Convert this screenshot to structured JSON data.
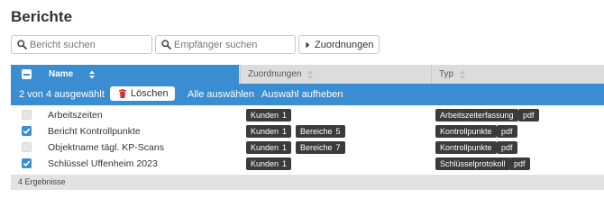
{
  "page": {
    "title": "Berichte"
  },
  "toolbar": {
    "report_search_placeholder": "Bericht suchen",
    "recipient_search_placeholder": "Empfänger suchen",
    "assignments_button": "Zuordnungen"
  },
  "table": {
    "columns": {
      "name": "Name",
      "assignments": "Zuordnungen",
      "type": "Typ"
    },
    "selection": {
      "count_text": "2 von 4 ausgewählt",
      "delete_label": "Löschen",
      "select_all": "Alle auswählen",
      "deselect": "Auswahl aufheben"
    },
    "rows": [
      {
        "name": "Arbeitszeiten",
        "checked": false,
        "kunden": {
          "label": "Kunden",
          "count": "1"
        },
        "bereiche": null,
        "type": "Arbeitszeiterfassung",
        "format": "pdf"
      },
      {
        "name": "Bericht Kontrollpunkte",
        "checked": true,
        "kunden": {
          "label": "Kunden",
          "count": "1"
        },
        "bereiche": {
          "label": "Bereiche",
          "count": "5"
        },
        "type": "Kontrollpunkte",
        "format": "pdf"
      },
      {
        "name": "Objektname tägl. KP-Scans",
        "checked": false,
        "kunden": {
          "label": "Kunden",
          "count": "1"
        },
        "bereiche": {
          "label": "Bereiche",
          "count": "7"
        },
        "type": "Kontrollpunkte",
        "format": "pdf"
      },
      {
        "name": "Schlüssel Uffenheim 2023",
        "checked": true,
        "kunden": {
          "label": "Kunden",
          "count": "1"
        },
        "bereiche": null,
        "type": "Schlüsselprotokoll",
        "format": "pdf"
      }
    ],
    "footer": "4 Ergebnisse"
  },
  "colors": {
    "accent": "#3a8dd0",
    "tag": "#3b3b3b"
  },
  "icons": [
    "search-icon",
    "chevron-right-icon",
    "sort-icon",
    "trash-icon",
    "check-icon",
    "minus-icon"
  ]
}
